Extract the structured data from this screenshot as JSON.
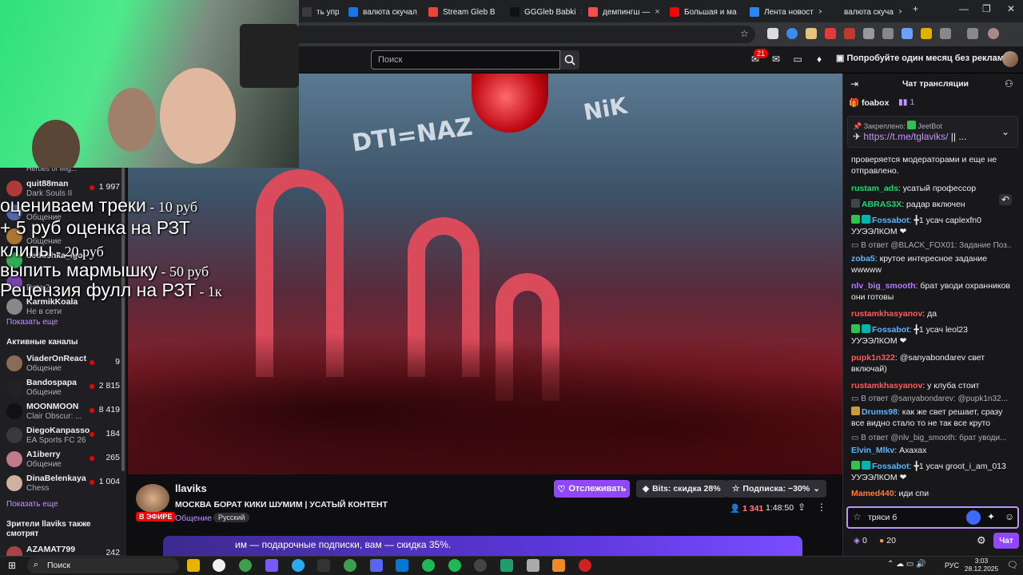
{
  "browser": {
    "tabs": [
      {
        "label": "ть управ",
        "color": "#3b3b3b"
      },
      {
        "label": "валюта скучал",
        "color": "#1a73e8"
      },
      {
        "label": "Stream Gleb B",
        "color": "#e8453c"
      },
      {
        "label": "GGGleb Babki",
        "color": "#111111"
      },
      {
        "label": "демпингш — ",
        "color": "#ff4d4d"
      },
      {
        "label": "Большая и ма",
        "color": "#ff0000"
      },
      {
        "label": "Лента новост",
        "color": "#2787f5"
      },
      {
        "label": "валюта скуча",
        "color": "#222222"
      }
    ],
    "new_tab": "+"
  },
  "topbar": {
    "search_placeholder": "Поиск",
    "notif_count": "21",
    "promo": "Попробуйте один месяц без рекламы"
  },
  "sidebar": {
    "top_items": [
      {
        "name": "quit88man",
        "game": "Dark Souls II",
        "viewers": "1 997",
        "color": "#b03a3a"
      },
      {
        "name": "",
        "game": "Общение",
        "viewers": "",
        "color": "#5566aa"
      },
      {
        "name": "",
        "game": "Общение",
        "viewers": "",
        "color": "#aa7733"
      },
      {
        "name": "dedushka_igor",
        "game": "",
        "viewers": "",
        "color": "#33aa55"
      },
      {
        "name": "",
        "game": "Dota 2",
        "viewers": "",
        "color": "#7744aa"
      },
      {
        "name": "KarmikKoala",
        "game": "Не в сети",
        "viewers": "",
        "color": "#888888"
      }
    ],
    "show_more": "Показать еще",
    "active_title": "Активные каналы",
    "active": [
      {
        "name": "ViaderOnReact",
        "game": "Общение",
        "viewers": "9",
        "color": "#8a6b5a"
      },
      {
        "name": "Bandospapa",
        "game": "Общение",
        "viewers": "2 815",
        "color": "#222222"
      },
      {
        "name": "MOONMOON",
        "game": "Clair Obscur: ...",
        "viewers": "8 419",
        "color": "#111111"
      },
      {
        "name": "DiegoKanpasso",
        "game": "EA Sports FC 26",
        "viewers": "184",
        "color": "#3a3a3a"
      },
      {
        "name": "A1iberry",
        "game": "Общение",
        "viewers": "265",
        "color": "#c07a8a"
      },
      {
        "name": "DinaBelenkaya",
        "game": "Chess",
        "viewers": "1 004",
        "color": "#d0b0a0"
      }
    ],
    "show_more2": "Показать еще",
    "also_watch": "Зрители llaviks также смотрят",
    "last": {
      "name": "AZAMAT799",
      "viewers": "242"
    },
    "partial_top": "Heroes of Mig..."
  },
  "overlay": {
    "lines": [
      {
        "text": "оцениваем треки",
        "price": " - 10 руб"
      },
      {
        "text": "+ 5 руб оценка на РЗТ",
        "price": ""
      },
      {
        "text": "клипы",
        "price": " - 20 руб"
      },
      {
        "text": "выпить мармышку",
        "price": " - 50 руб"
      },
      {
        "text": "Рецензия фулл на РЗТ",
        "price": " - 1к"
      }
    ]
  },
  "stream": {
    "channel": "llaviks",
    "title": "МОСКВА БОРАТ КИКИ ШУМИМ | УСАТЫЙ КОНТЕНТ",
    "live": "В ЭФИРЕ",
    "category": "Общение",
    "tag": "Русский",
    "viewers": "1 341",
    "uptime": "1:48:50",
    "follow": "Отслеживать",
    "bits": "Bits: скидка 28%",
    "sub": "Подписка: −30%",
    "banner": "им — подарочные подписки, вам — скидка 35%."
  },
  "chat": {
    "title": "Чат трансляции",
    "hype_user": "foabox",
    "hype_count": "1",
    "pinned_label": "Закреплено:",
    "pinned_by": "JeetBot",
    "pinned_link": "https://t.me/tglaviks/",
    "pinned_suffix": " || ...",
    "messages": [
      {
        "type": "text",
        "user": "",
        "ucolor": "#efeff1",
        "text": "проверяется модераторами и еще не отправлено."
      },
      {
        "type": "text",
        "user": "rustam_ads",
        "ucolor": "#1cd673",
        "text": ": усатый профессор"
      },
      {
        "type": "text",
        "user": "ABRAS3X",
        "ucolor": "#1cd673",
        "text": ": радар включен"
      },
      {
        "type": "text",
        "user": "Fossabot",
        "ucolor": "#5ab5ff",
        "text": ": ╋1 усач caplexfn0 УУЭЭЛКОМ ❤"
      },
      {
        "type": "reply",
        "text": "В ответ @BLACK_FOX01: Задание Поз..."
      },
      {
        "type": "text",
        "user": "zoba5",
        "ucolor": "#5ab5ff",
        "text": ": крутое интересное задание wwwww"
      },
      {
        "type": "text",
        "user": "nlv_big_smooth",
        "ucolor": "#b57aff",
        "text": ": брат уводи охранников они готовы"
      },
      {
        "type": "text",
        "user": "rustamkhasyanov",
        "ucolor": "#ff5a5a",
        "text": ": да"
      },
      {
        "type": "text",
        "user": "Fossabot",
        "ucolor": "#5ab5ff",
        "text": ": ╋1 усач leol23 УУЭЭЛКОМ ❤"
      },
      {
        "type": "text",
        "user": "pupk1n322",
        "ucolor": "#ff5a5a",
        "text": ": @sanyabondarev свет включай)"
      },
      {
        "type": "text",
        "user": "rustamkhasyanov",
        "ucolor": "#ff5a5a",
        "text": ": у клуба стоит"
      },
      {
        "type": "reply",
        "text": "В ответ @sanyabondarev: @pupk1n32..."
      },
      {
        "type": "text",
        "user": "Drums98",
        "ucolor": "#5ab5ff",
        "text": ": как же свет решает, сразу все видно стало то не так все круто"
      },
      {
        "type": "reply",
        "text": "В ответ @nlv_big_smooth: брат уводи..."
      },
      {
        "type": "text",
        "user": "Elvin_Mlkv",
        "ucolor": "#5ab5ff",
        "text": ": Ахахах"
      },
      {
        "type": "text",
        "user": "Fossabot",
        "ucolor": "#5ab5ff",
        "text": ": ╋1 усач groot_i_am_013 УУЭЭЛКОМ ❤"
      },
      {
        "type": "text",
        "user": "Mamed440",
        "ucolor": "#ff7a3a",
        "text": ": иди спи"
      }
    ],
    "input_value": "тряси б",
    "points": "0",
    "bits_count": "20",
    "send": "Чат"
  },
  "taskbar": {
    "search": "Поиск",
    "lang": "РУС",
    "time": "3:03",
    "date": "28.12.2025"
  }
}
